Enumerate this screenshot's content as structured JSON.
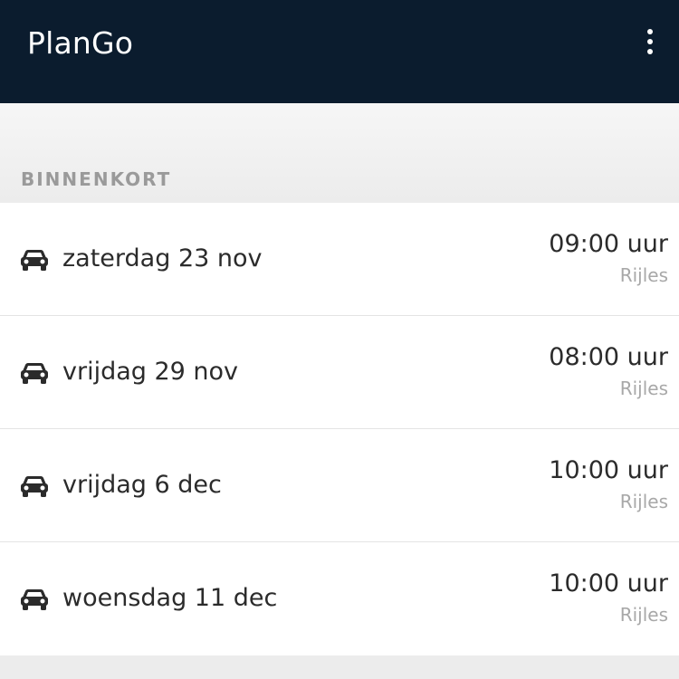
{
  "app": {
    "title": "PlanGo"
  },
  "header": {
    "menu_icon": "more-vertical-icon"
  },
  "section": {
    "label": "BINNENKORT"
  },
  "appointments": [
    {
      "date": "zaterdag 23 nov",
      "time": "09:00 uur",
      "type": "Rijles",
      "icon": "car-icon"
    },
    {
      "date": "vrijdag 29 nov",
      "time": "08:00 uur",
      "type": "Rijles",
      "icon": "car-icon"
    },
    {
      "date": "vrijdag 6 dec",
      "time": "10:00 uur",
      "type": "Rijles",
      "icon": "car-icon"
    },
    {
      "date": "woensdag 11 dec",
      "time": "10:00 uur",
      "type": "Rijles",
      "icon": "car-icon"
    }
  ],
  "colors": {
    "header_bg": "#0b1c2e",
    "page_bg": "#ececec",
    "text_primary": "#2b2b2b",
    "text_secondary": "#a8a8a8",
    "section_label": "#9a9a9a"
  }
}
